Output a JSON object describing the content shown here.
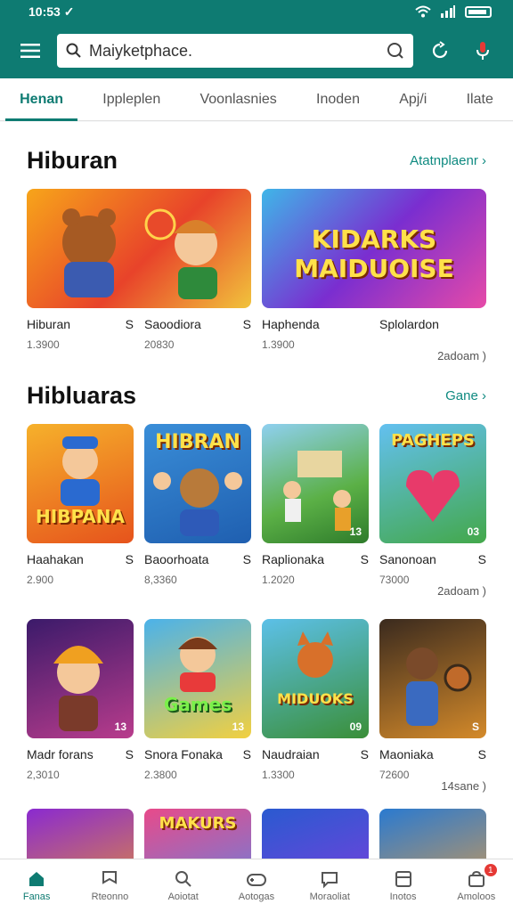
{
  "status": {
    "time": "10:53 ✓"
  },
  "search": {
    "placeholder": "Maiyketphace."
  },
  "tabs": [
    "Henan",
    "Ippleplen",
    "Voonlasnies",
    "Inoden",
    "Apj/i",
    "Ilate"
  ],
  "sections": [
    {
      "title": "Hiburan",
      "link": "Atatnplaenr ›",
      "items": [
        {
          "name": "Hiburan",
          "price": "S",
          "sub": "1.3900",
          "tile_text": ""
        },
        {
          "name": "Saoodiora",
          "price": "S",
          "sub": "20830",
          "tile_text": ""
        },
        {
          "name": "Haphenda",
          "price": "",
          "sub": "1.3900",
          "tile_text": "KIDARKS MAIDUOISE"
        },
        {
          "name": "Splolardon",
          "price": "",
          "sub": "",
          "tile_text": ""
        }
      ],
      "more": "2adoam )"
    },
    {
      "title": "Hibluaras",
      "link": "Gane ›",
      "items": [
        {
          "name": "Haahakan",
          "price": "S",
          "sub": "2.900",
          "tile_text": "HIBPANA",
          "badge": ""
        },
        {
          "name": "Baoorhoata",
          "price": "S",
          "sub": "8,3360",
          "tile_text": "HIBRAN",
          "badge": ""
        },
        {
          "name": "Raplionaka",
          "price": "S",
          "sub": "1.2020",
          "tile_text": "",
          "badge": "13"
        },
        {
          "name": "Sanonoan",
          "price": "S",
          "sub": "73000",
          "tile_text": "PAGHEPS",
          "badge": "03"
        }
      ],
      "more": "2adoam )"
    },
    {
      "title": "",
      "link": "",
      "items": [
        {
          "name": "Madr forans",
          "price": "S",
          "sub": "2,3010",
          "tile_text": "",
          "badge": "13"
        },
        {
          "name": "Snora Fonaka",
          "price": "S",
          "sub": "2.3800",
          "tile_text": "Games",
          "badge": "13"
        },
        {
          "name": "Naudraian",
          "price": "S",
          "sub": "1.3300",
          "tile_text": "MIDUOKS",
          "badge": "09"
        },
        {
          "name": "Maoniaka",
          "price": "S",
          "sub": "72600",
          "tile_text": "",
          "badge": "S"
        }
      ],
      "more": "14sane )"
    },
    {
      "title": "",
      "link": "",
      "items": [
        {
          "name": "",
          "tile_text": ""
        },
        {
          "name": "",
          "tile_text": "MAKURS"
        },
        {
          "name": "",
          "tile_text": ""
        },
        {
          "name": "",
          "tile_text": ""
        }
      ]
    }
  ],
  "bottom_nav": [
    {
      "label": "Fanas",
      "icon": "home-icon"
    },
    {
      "label": "Rteonno",
      "icon": "flag-icon"
    },
    {
      "label": "Aoiotat",
      "icon": "search-icon"
    },
    {
      "label": "Aotogas",
      "icon": "gamepad-icon"
    },
    {
      "label": "Moraoliat",
      "icon": "chat-icon"
    },
    {
      "label": "Inotos",
      "icon": "book-icon"
    },
    {
      "label": "Amoloos",
      "icon": "store-icon",
      "badge": "1"
    }
  ]
}
